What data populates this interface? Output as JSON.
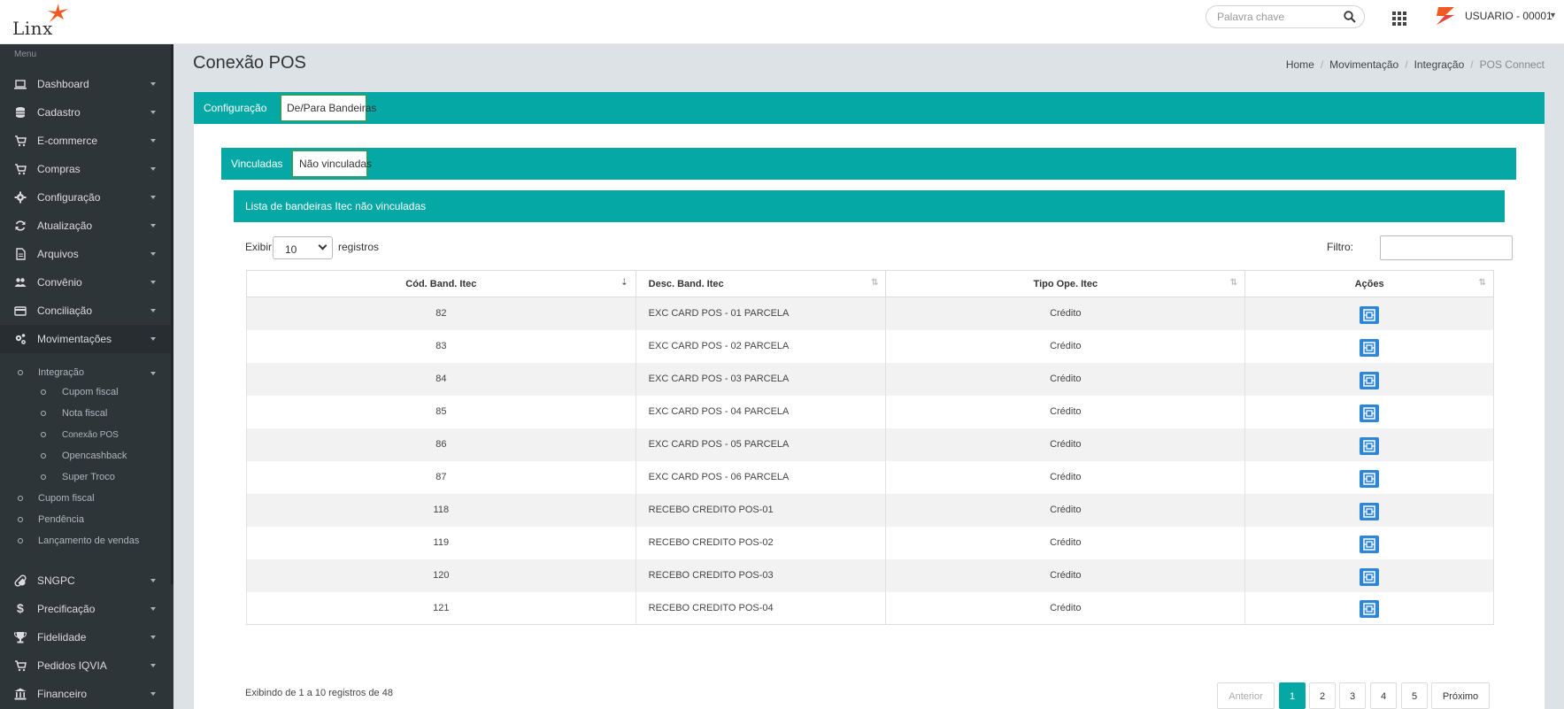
{
  "app": {
    "logo_text": "Linx",
    "search_placeholder": "Palavra chave",
    "user_name": "USUARIO - 00001"
  },
  "sidebar": {
    "title": "Menu",
    "items": [
      {
        "label": "Dashboard",
        "icon": "laptop-icon"
      },
      {
        "label": "Cadastro",
        "icon": "database-icon"
      },
      {
        "label": "E-commerce",
        "icon": "cart-icon"
      },
      {
        "label": "Compras",
        "icon": "cart-icon"
      },
      {
        "label": "Configuração",
        "icon": "gear-icon"
      },
      {
        "label": "Atualização",
        "icon": "refresh-icon"
      },
      {
        "label": "Arquivos",
        "icon": "file-icon"
      },
      {
        "label": "Convênio",
        "icon": "users-icon"
      },
      {
        "label": "Conciliação",
        "icon": "credit-card-icon"
      },
      {
        "label": "Movimentações",
        "icon": "gears-icon"
      },
      {
        "label": "SNGPC",
        "icon": "pill-icon"
      },
      {
        "label": "Precificação",
        "icon": "dollar-icon"
      },
      {
        "label": "Fidelidade",
        "icon": "trophy-icon"
      },
      {
        "label": "Pedidos IQVIA",
        "icon": "cart-icon"
      },
      {
        "label": "Financeiro",
        "icon": "bank-icon"
      }
    ],
    "subitems": {
      "integracao": "Integração",
      "cupom_fiscal_1": "Cupom fiscal",
      "nota_fiscal": "Nota fiscal",
      "conexao_pos": "Conexão POS",
      "opencashback": "Opencashback",
      "super_troco": "Super Troco",
      "cupom_fiscal_2": "Cupom fiscal",
      "pendencia": "Pendência",
      "lancamento_vendas": "Lançamento de vendas"
    }
  },
  "page": {
    "title": "Conexão POS",
    "breadcrumb": [
      "Home",
      "Movimentação",
      "Integração",
      "POS Connect"
    ]
  },
  "tabs": {
    "main": [
      "Configuração",
      "De/Para Bandeiras"
    ],
    "main_active": "De/Para Bandeiras",
    "sub": [
      "Vinculadas",
      "Não vinculadas"
    ],
    "sub_active": "Não vinculadas"
  },
  "list": {
    "header": "Lista de bandeiras Itec não vinculadas",
    "exibir_label": "Exibir",
    "page_size": "10",
    "registros_label": "registros",
    "filtro_label": "Filtro:",
    "filtro_value": "",
    "columns": [
      "Cód. Band. Itec",
      "Desc. Band. Itec",
      "Tipo Ope. Itec",
      "Ações"
    ],
    "rows": [
      {
        "cod": "82",
        "desc": "EXC CARD POS - 01 PARCELA",
        "tipo": "Crédito"
      },
      {
        "cod": "83",
        "desc": "EXC CARD POS - 02 PARCELA",
        "tipo": "Crédito"
      },
      {
        "cod": "84",
        "desc": "EXC CARD POS - 03 PARCELA",
        "tipo": "Crédito"
      },
      {
        "cod": "85",
        "desc": "EXC CARD POS - 04 PARCELA",
        "tipo": "Crédito"
      },
      {
        "cod": "86",
        "desc": "EXC CARD POS - 05 PARCELA",
        "tipo": "Crédito"
      },
      {
        "cod": "87",
        "desc": "EXC CARD POS - 06 PARCELA",
        "tipo": "Crédito"
      },
      {
        "cod": "118",
        "desc": "RECEBO CREDITO POS-01",
        "tipo": "Crédito"
      },
      {
        "cod": "119",
        "desc": "RECEBO CREDITO POS-02",
        "tipo": "Crédito"
      },
      {
        "cod": "120",
        "desc": "RECEBO CREDITO POS-03",
        "tipo": "Crédito"
      },
      {
        "cod": "121",
        "desc": "RECEBO CREDITO POS-04",
        "tipo": "Crédito"
      }
    ],
    "info": "Exibindo de 1 a 10 registros de 48",
    "pager": {
      "prev": "Anterior",
      "pages": [
        "1",
        "2",
        "3",
        "4",
        "5"
      ],
      "current": "1",
      "next": "Próximo"
    }
  },
  "colors": {
    "accent": "#06a8a6",
    "sidebar_bg": "#2e3539",
    "action_button": "#2f86d4",
    "content_bg": "#dde2e6"
  }
}
